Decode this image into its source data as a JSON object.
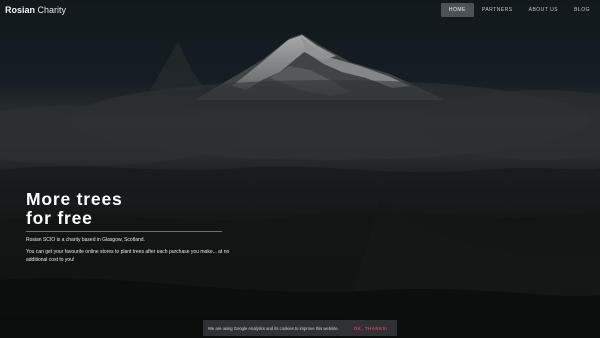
{
  "brand": {
    "bold": "Rosian",
    "light": "Charity"
  },
  "nav": {
    "items": [
      {
        "label": "HOME",
        "active": true
      },
      {
        "label": "PARTNERS",
        "active": false
      },
      {
        "label": "ABOUT US",
        "active": false
      },
      {
        "label": "BLOG",
        "active": false
      }
    ]
  },
  "hero": {
    "title_line1": "More trees",
    "title_line2": "for free",
    "tagline": "Rosian SCIO is a charity based in Glasgow, Scotland.",
    "description_line1": "You can get your favourite online stores to plant trees after each purchase you make... at no",
    "description_line2": "additional cost to you!"
  },
  "cookie": {
    "message": "We are using Google Analytics and its cookies to improve this website.",
    "button": "OK, THANKS!"
  },
  "colors": {
    "accent": "#d1485d",
    "nav_active_bg": "#4d5256"
  }
}
